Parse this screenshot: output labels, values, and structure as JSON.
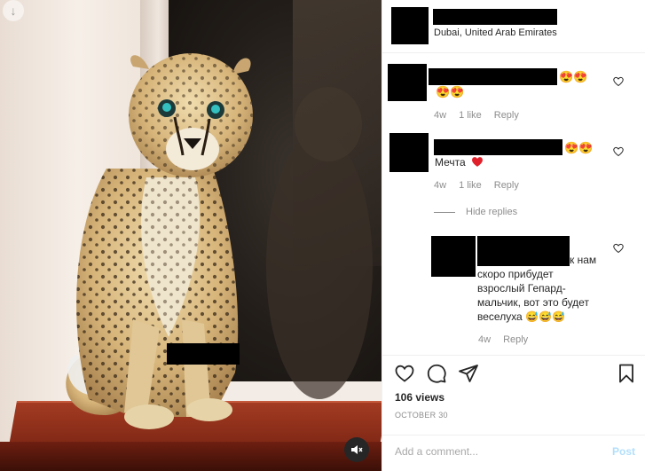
{
  "post": {
    "location": "Dubai, United Arab Emirates",
    "views": "106 views",
    "date": "OCTOBER 30"
  },
  "comments": [
    {
      "emojis": "😍😍",
      "emojis_line2": "😍😍",
      "age": "4w",
      "likes": "1 like",
      "reply": "Reply"
    },
    {
      "emojis": "😍😍",
      "text": "Мечта",
      "age": "4w",
      "likes": "1 like",
      "reply": "Reply"
    }
  ],
  "hide_replies": "Hide replies",
  "reply": {
    "text_inline": "к нам",
    "text_lines": [
      "скоро прибудет",
      "взрослый Гепард-",
      "мальчик, вот это будет",
      "веселуха 😅😅😅"
    ],
    "age": "4w",
    "reply": "Reply"
  },
  "add_comment": {
    "placeholder": "Add a comment...",
    "post_label": "Post"
  },
  "icons": {
    "download": "download-arrow-icon",
    "mute": "muted-speaker-icon",
    "like": "heart-outline-icon",
    "comment": "speech-bubble-icon",
    "share": "paper-plane-icon",
    "save": "bookmark-icon",
    "comment_like": "small-heart-icon",
    "love": "red-heart-emoji"
  },
  "colors": {
    "text": "#262626",
    "muted": "#8e8e8e",
    "post_disabled": "#b2dffc",
    "redaction": "#000000",
    "sill": "#8a2a17"
  }
}
